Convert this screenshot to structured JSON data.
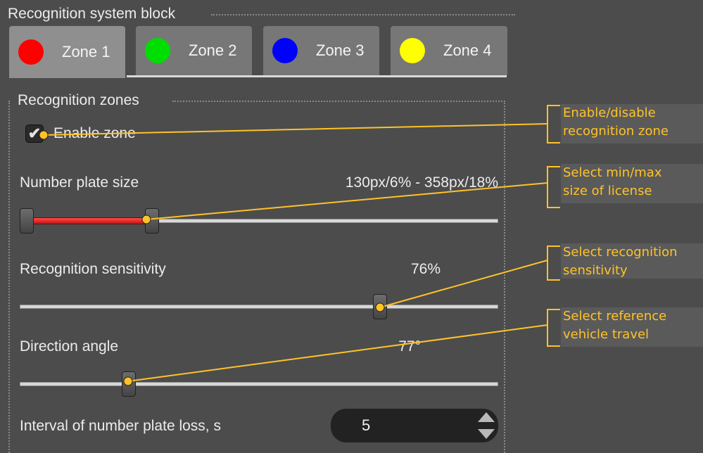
{
  "window": {
    "group_title": "Recognition system block"
  },
  "tabs": [
    {
      "label": "Zone 1",
      "color": "#ff0000",
      "active": true
    },
    {
      "label": "Zone 2",
      "color": "#00dd00",
      "active": false
    },
    {
      "label": "Zone 3",
      "color": "#0000ff",
      "active": false
    },
    {
      "label": "Zone 4",
      "color": "#ffff00",
      "active": false
    }
  ],
  "zones": {
    "group_title": "Recognition zones",
    "enable_label": "Enable zone",
    "enable_checked": true,
    "plate_size": {
      "label": "Number plate size",
      "value_text": "130px/6% - 358px/18%",
      "min_fraction": 0.0,
      "max_fraction": 0.27
    },
    "sensitivity": {
      "label": "Recognition sensitivity",
      "value_text": "76%",
      "fraction": 0.76
    },
    "direction": {
      "label": "Direction angle",
      "value_text": "77°",
      "fraction": 0.22
    },
    "interval": {
      "label": "Interval of number plate loss, s",
      "value": "5"
    }
  },
  "annotations": [
    {
      "line1": "Enable/disable",
      "line2": "recognition zone"
    },
    {
      "line1": "Select min/max",
      "line2": "size of license"
    },
    {
      "line1": "Select recognition",
      "line2": "sensitivity"
    },
    {
      "line1": "Select reference",
      "line2": "vehicle travel"
    }
  ],
  "colors": {
    "annotation": "#ffc328",
    "background": "#4c4c4c",
    "range_fill": "#e02020"
  }
}
